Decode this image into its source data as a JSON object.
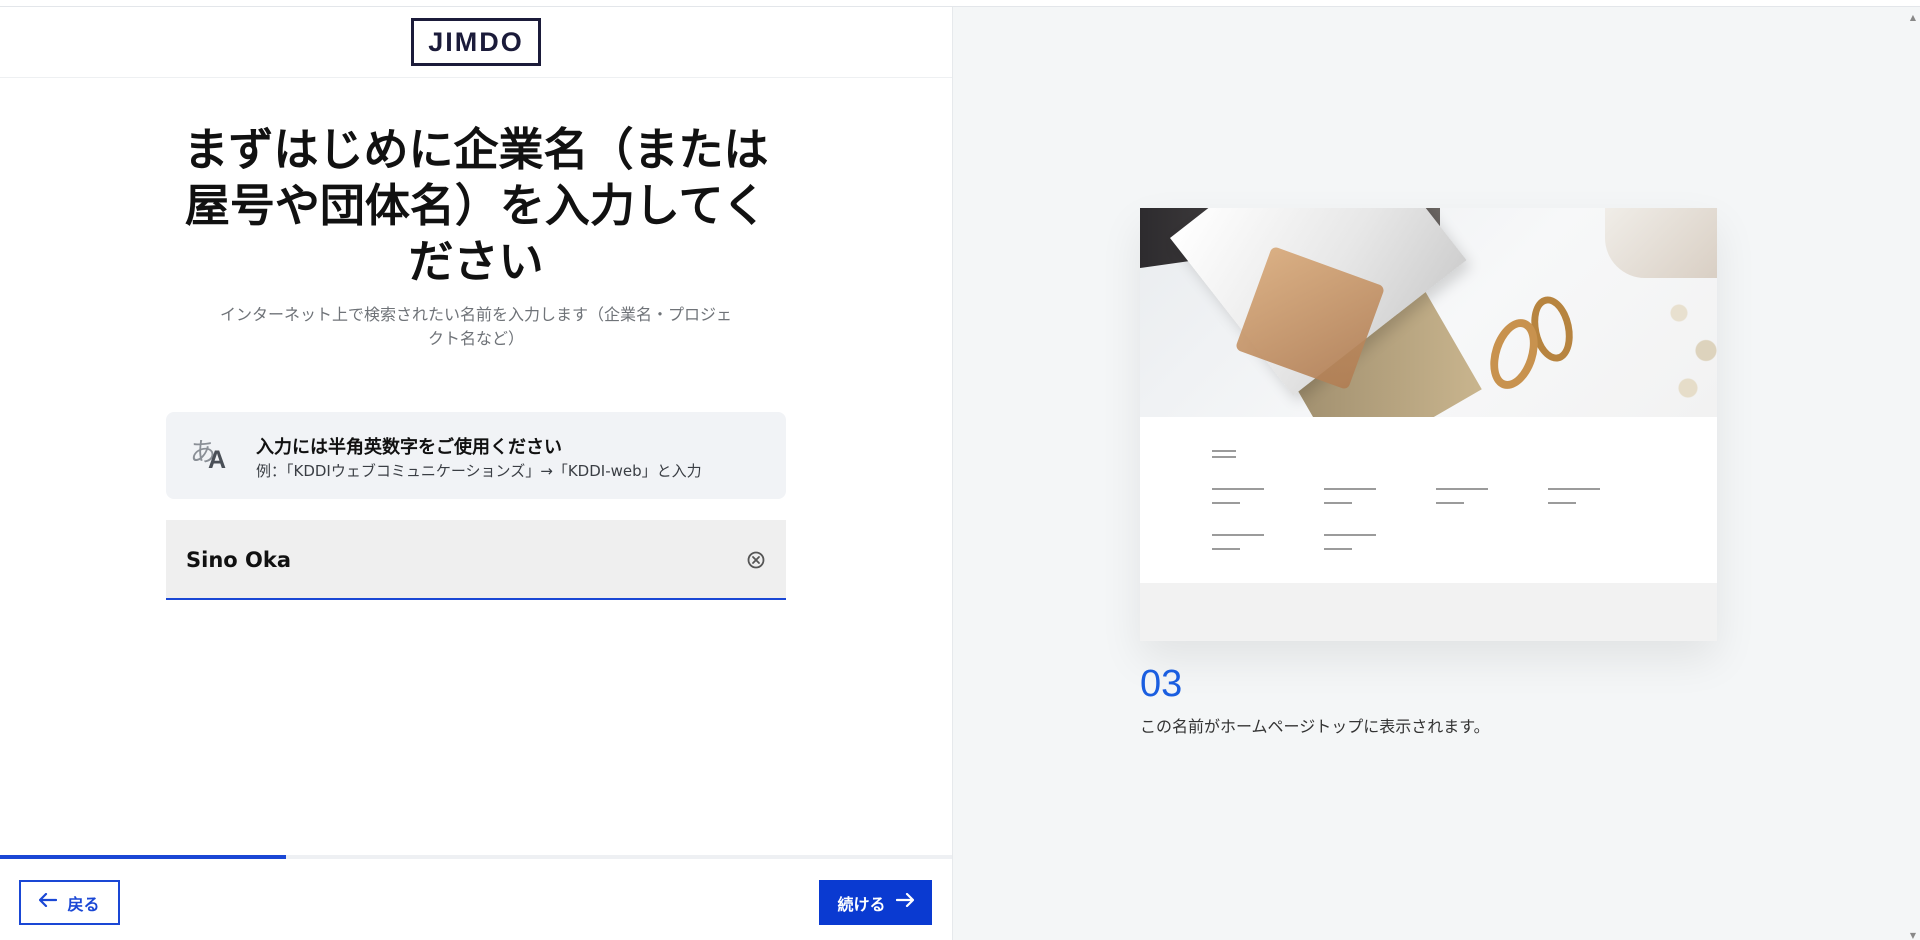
{
  "header": {
    "logo": "JIMDO"
  },
  "main": {
    "title": "まずはじめに企業名（または屋号や団体名）を入力してください",
    "subtitle": "インターネット上で検索されたい名前を入力します（企業名・プロジェクト名など）",
    "hint": {
      "icon": "japanese-input-icon",
      "icon_glyph_small": "あ",
      "icon_glyph_large": "A",
      "title": "入力には半角英数字をご使用ください",
      "text": "例：「KDDIウェブコミュニケーションズ」→「KDDI-web」と入力"
    },
    "input": {
      "value": "Sino Oka",
      "clear_icon": "clear-circle-icon"
    }
  },
  "progress": {
    "fraction": 0.3
  },
  "footer": {
    "back_label": "戻る",
    "next_label": "続ける",
    "back_icon": "arrow-left-icon",
    "next_icon": "arrow-right-icon"
  },
  "preview": {
    "step_number": "03",
    "caption": "この名前がホームページトップに表示されます。"
  },
  "colors": {
    "accent": "#1a47d5",
    "button": "#0a3ad1",
    "step": "#1a5ee0"
  }
}
